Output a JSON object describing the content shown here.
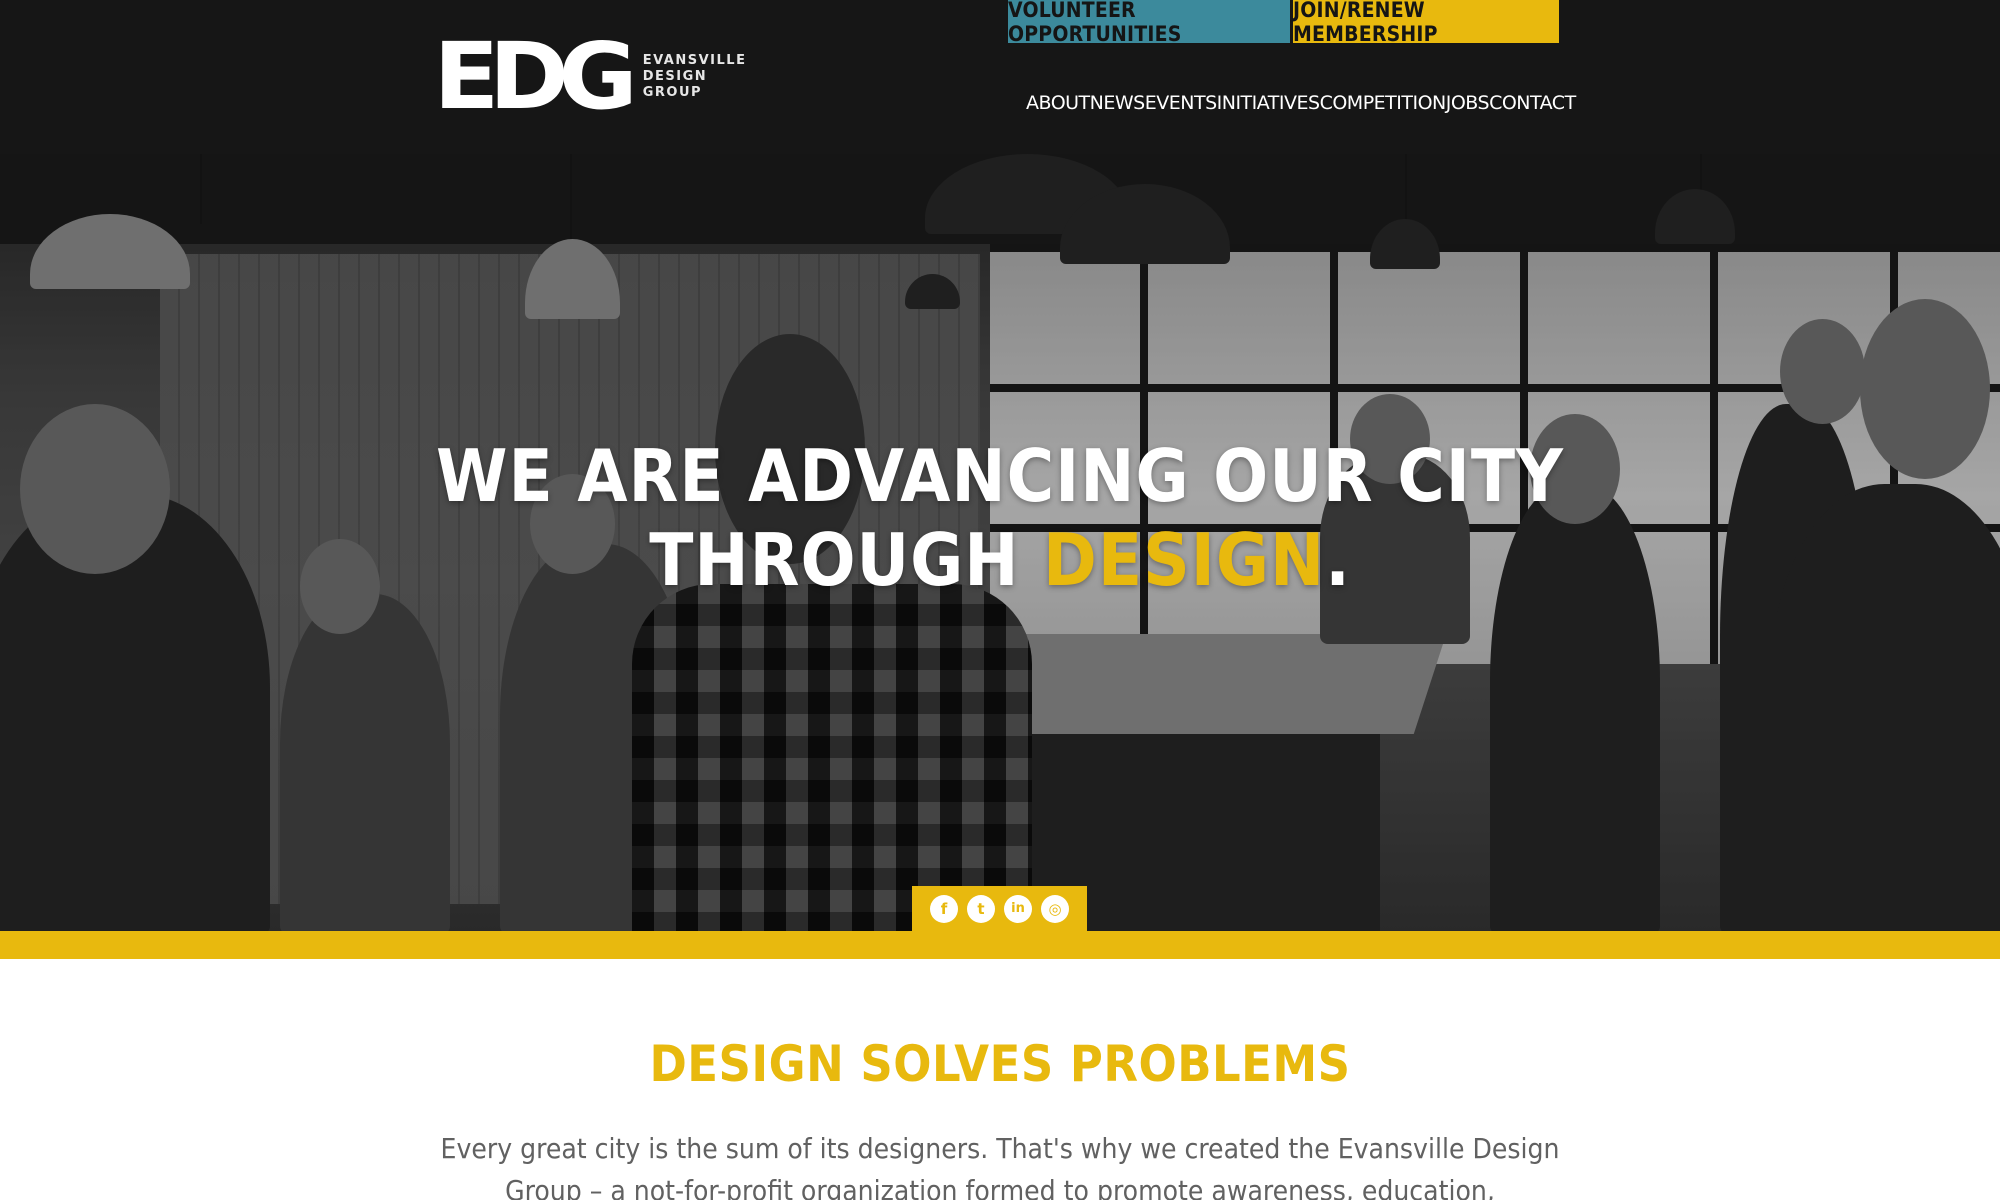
{
  "header": {
    "logo": {
      "mark": "EDG",
      "text_lines": [
        "EVANSVILLE",
        "DESIGN",
        "GROUP"
      ]
    },
    "cta": {
      "volunteer_label": "VOLUNTEER OPPORTUNITIES",
      "join_label": "JOIN/RENEW MEMBERSHIP"
    },
    "nav": [
      "ABOUT",
      "NEWS",
      "EVENTS",
      "INITIATIVES",
      "COMPETITION",
      "JOBS",
      "CONTACT"
    ]
  },
  "hero": {
    "headline_line1": "WE ARE ADVANCING OUR CITY",
    "headline_line2_start": "THROUGH ",
    "headline_line2_accent": "DESIGN",
    "headline_line2_end": "."
  },
  "social": [
    {
      "icon": "facebook-icon",
      "glyph": "f"
    },
    {
      "icon": "twitter-icon",
      "glyph": "t"
    },
    {
      "icon": "linkedin-icon",
      "glyph": "in"
    },
    {
      "icon": "instagram-icon",
      "glyph": "◎"
    }
  ],
  "content": {
    "title": "DESIGN SOLVES PROBLEMS",
    "body": "Every great city is the sum of its designers. That's why we created the Evansville Design Group – a not-for-profit organization formed to promote awareness, education, networking, and enrichment"
  },
  "colors": {
    "header_bg": "#161616",
    "accent_yellow": "#e8b90e",
    "teal": "#3c8a9c",
    "body_text": "#616161"
  }
}
